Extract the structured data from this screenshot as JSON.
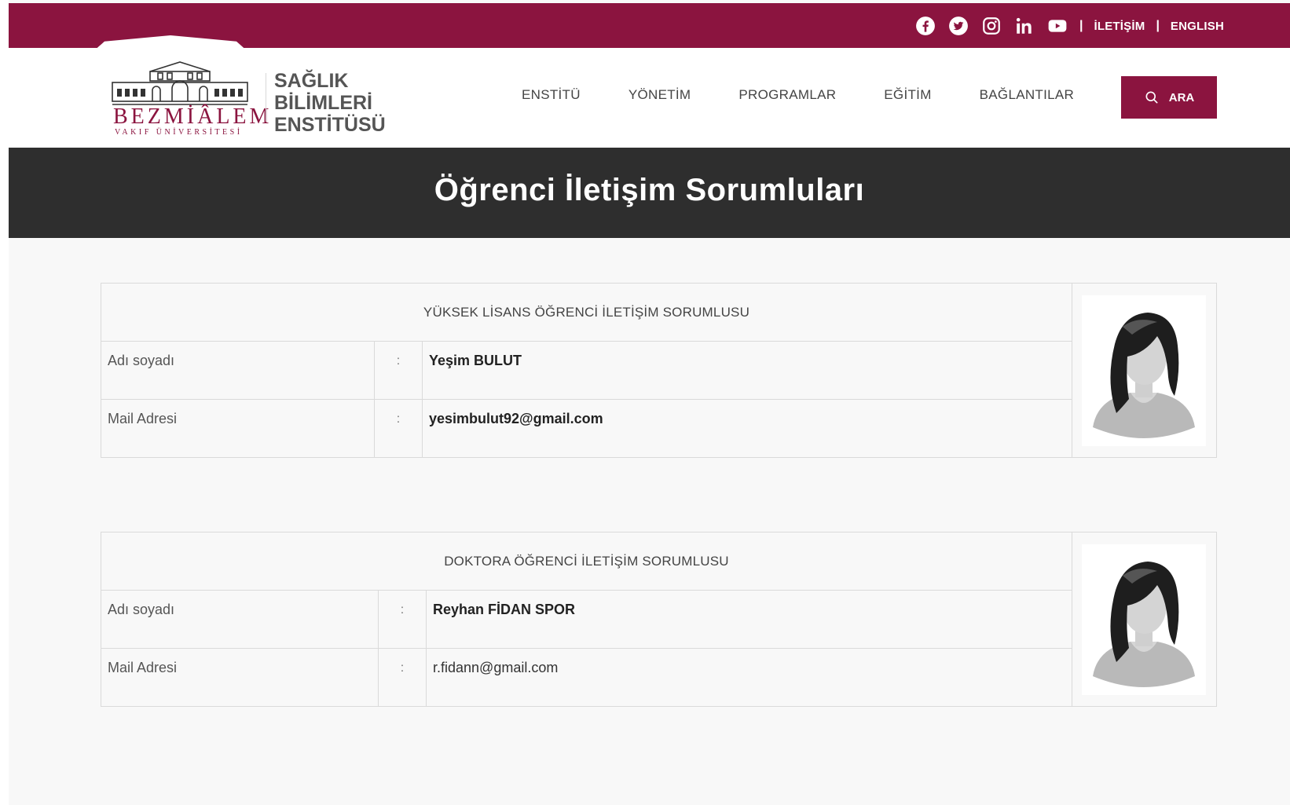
{
  "topbar": {
    "social_icons": [
      "facebook-icon",
      "twitter-icon",
      "instagram-icon",
      "linkedin-icon",
      "youtube-icon"
    ],
    "contact_link": "İLETİŞİM",
    "language_link": "ENGLISH",
    "separator": "|"
  },
  "logo": {
    "name": "BEZMİÂLEM",
    "subtitle": "VAKIF ÜNİVERSİTESİ"
  },
  "institute": {
    "line1": "SAĞLIK",
    "line2": "BİLİMLERİ",
    "line3": "ENSTİTÜSÜ"
  },
  "nav": {
    "items": [
      {
        "label": "ENSTİTÜ"
      },
      {
        "label": "YÖNETİM"
      },
      {
        "label": "PROGRAMLAR"
      },
      {
        "label": "EĞİTİM"
      },
      {
        "label": "BAĞLANTILAR"
      }
    ],
    "search_label": "ARA"
  },
  "page_title": "Öğrenci İletişim Sorumluları",
  "cards": [
    {
      "heading": "YÜKSEK LİSANS ÖĞRENCİ İLETİŞİM SORUMLUSU",
      "name_label": "Adı soyadı",
      "name_value": "Yeşim BULUT",
      "mail_label": "Mail Adresi",
      "mail_value": "yesimbulut92@gmail.com",
      "colon": ":"
    },
    {
      "heading": "DOKTORA ÖĞRENCİ İLETİŞİM SORUMLUSU",
      "name_label": "Adı soyadı",
      "name_value": "Reyhan FİDAN SPOR",
      "mail_label": "Mail Adresi",
      "mail_value": "r.fidann@gmail.com",
      "colon": ":"
    }
  ],
  "colors": {
    "brand": "#8b143f",
    "title_band": "#2e2e2e",
    "background": "#f8f8f8"
  }
}
